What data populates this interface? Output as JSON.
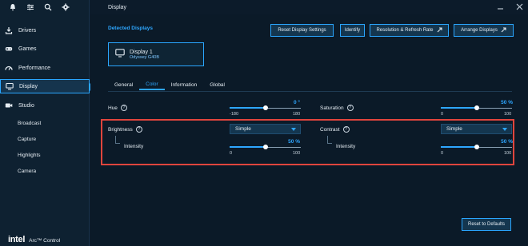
{
  "window": {
    "title": "Display"
  },
  "sidebar": {
    "items": [
      {
        "label": "Drivers",
        "icon": "download-icon"
      },
      {
        "label": "Games",
        "icon": "gamepad-icon"
      },
      {
        "label": "Performance",
        "icon": "gauge-icon"
      },
      {
        "label": "Display",
        "icon": "monitor-icon",
        "active": true
      },
      {
        "label": "Studio",
        "icon": "camera-icon"
      }
    ],
    "studio_subitems": [
      "Broadcast",
      "Capture",
      "Highlights",
      "Camera"
    ],
    "brand": {
      "logo": "intel",
      "product": "Arc™ Control"
    }
  },
  "header": {
    "section_title": "Detected Displays",
    "buttons": {
      "reset_display": "Reset Display Settings",
      "identify": "Identify",
      "resolution": "Resolution & Refresh Rate",
      "arrange": "Arrange Displays"
    }
  },
  "display_card": {
    "name": "Display 1",
    "model": "Odyssey G40B"
  },
  "tabs": [
    "General",
    "Color",
    "Information",
    "Global"
  ],
  "active_tab": "Color",
  "settings": {
    "hue": {
      "label": "Hue",
      "value": "0 °",
      "min": "-180",
      "max": "180",
      "level": 0.5
    },
    "saturation": {
      "label": "Saturation",
      "value": "50 %",
      "min": "0",
      "max": "100",
      "level": 0.5
    },
    "brightness": {
      "label": "Brightness",
      "mode": "Simple",
      "sub_label": "Intensity",
      "value": "50 %",
      "min": "0",
      "max": "100",
      "level": 0.5
    },
    "contrast": {
      "label": "Contrast",
      "mode": "Simple",
      "sub_label": "Intensity",
      "value": "50 %",
      "min": "0",
      "max": "100",
      "level": 0.5
    }
  },
  "reset_defaults": "Reset to Defaults",
  "colors": {
    "accent": "#2ea7ff",
    "highlight_box": "#e0453d",
    "background": "#0b1a28"
  }
}
